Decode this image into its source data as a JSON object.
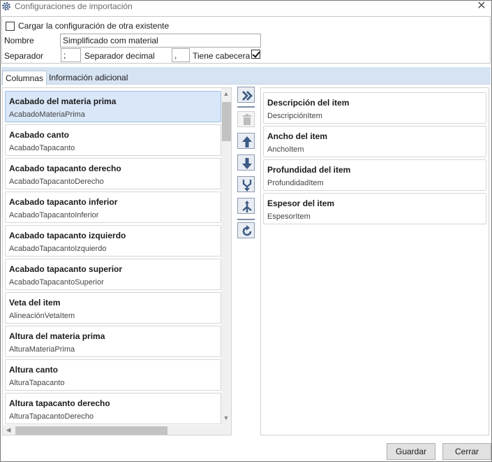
{
  "window": {
    "title": "Configuraciones de importación",
    "close_label": "✕"
  },
  "config": {
    "load_existing_label": "Cargar la configuración de otra existente",
    "load_existing_checked": false,
    "name_label": "Nombre",
    "name_value": "Simplificado com material",
    "separator_label": "Separador",
    "separator_value": ";",
    "decimal_label": "Separador decimal",
    "decimal_value": ",",
    "header_label": "Tiene cabecera",
    "header_checked": true
  },
  "tabs": [
    {
      "label": "Columnas",
      "active": true
    },
    {
      "label": "Información adicional",
      "active": false
    }
  ],
  "available_columns": [
    {
      "title": "Acabado del materia prima",
      "field": "AcabadoMateriaPrima",
      "selected": true
    },
    {
      "title": "Acabado canto",
      "field": "AcabadoTapacanto"
    },
    {
      "title": "Acabado tapacanto derecho",
      "field": "AcabadoTapacantoDerecho"
    },
    {
      "title": "Acabado tapacanto inferior",
      "field": "AcabadoTapacantoInferior"
    },
    {
      "title": "Acabado tapacanto izquierdo",
      "field": "AcabadoTapacantoIzquierdo"
    },
    {
      "title": "Acabado tapacanto superior",
      "field": "AcabadoTapacantoSuperior"
    },
    {
      "title": "Veta del item",
      "field": "AlineaciónVetaItem"
    },
    {
      "title": "Altura del materia prima",
      "field": "AlturaMateriaPrima"
    },
    {
      "title": "Altura canto",
      "field": "AlturaTapacanto"
    },
    {
      "title": "Altura tapacanto derecho",
      "field": "AlturaTapacantoDerecho"
    }
  ],
  "selected_columns": [
    {
      "title": "Descripción del item",
      "field": "DescripciónItem"
    },
    {
      "title": "Ancho del item",
      "field": "AnchoItem"
    },
    {
      "title": "Profundidad del item",
      "field": "ProfundidadItem"
    },
    {
      "title": "Espesor del item",
      "field": "EspesorItem"
    }
  ],
  "toolbar": [
    {
      "icon": "double-chevron-right-icon",
      "name": "add-column-button"
    },
    {
      "icon": "trash-icon",
      "name": "remove-column-button",
      "disabled": true
    },
    {
      "icon": "arrow-up-icon",
      "name": "move-up-button"
    },
    {
      "icon": "arrow-down-icon",
      "name": "move-down-button"
    },
    {
      "icon": "merge-down-icon",
      "name": "merge-button"
    },
    {
      "icon": "split-icon",
      "name": "split-button"
    },
    {
      "icon": "refresh-icon",
      "name": "refresh-button"
    }
  ],
  "buttons": {
    "save": "Guardar",
    "cancel": "Cerrar"
  },
  "colors": {
    "selected_bg": "#d9e7f8",
    "tab_strip": "#d6e3f2",
    "icon_blue": "#3d5c86"
  }
}
